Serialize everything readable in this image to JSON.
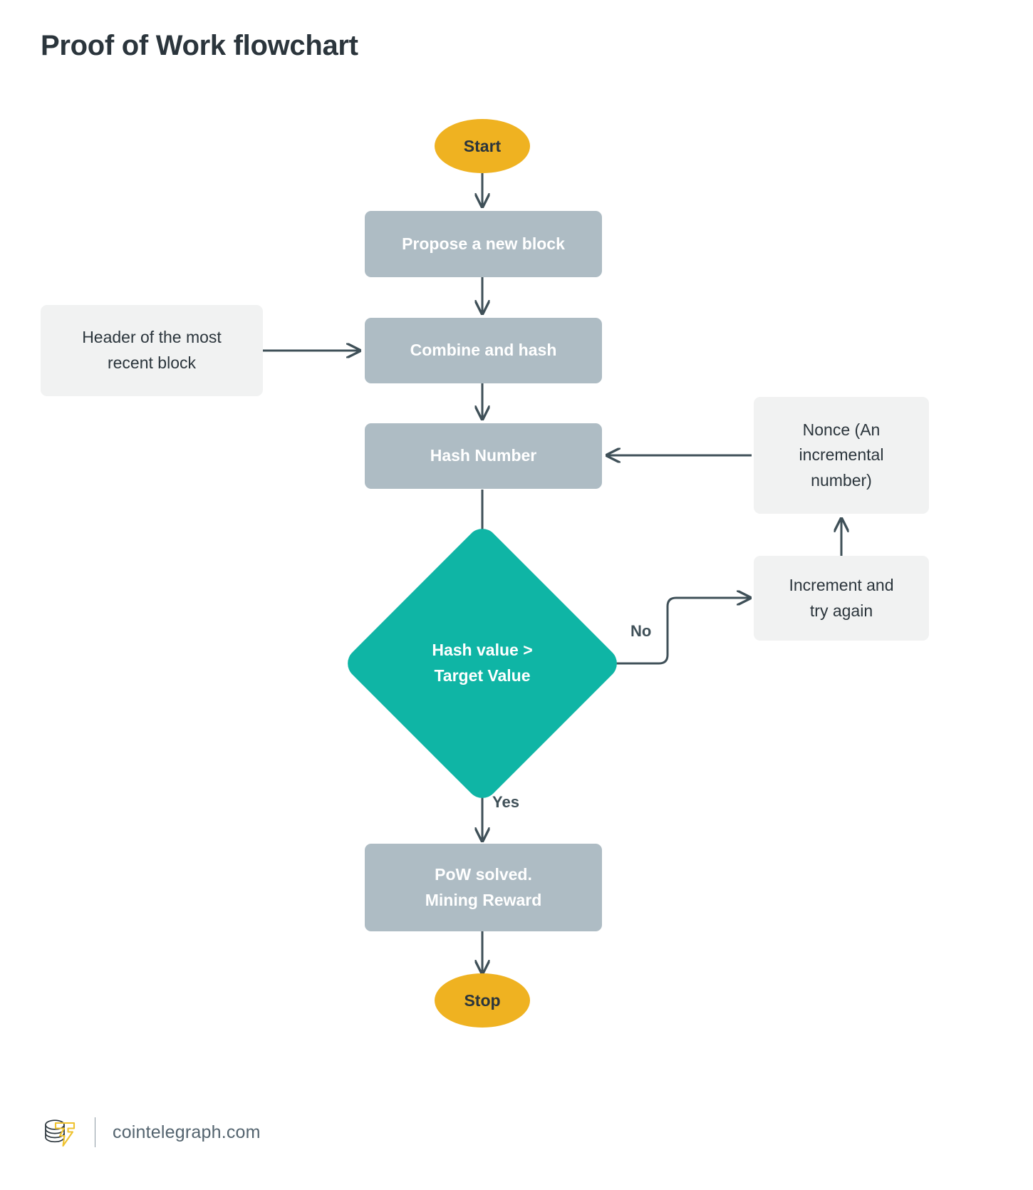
{
  "page": {
    "title": "Proof of Work flowchart",
    "background": "#ffffff"
  },
  "colors": {
    "title_text": "#2b353c",
    "terminal_fill": "#efb221",
    "terminal_text": "#2b353c",
    "process_fill": "#aebcc4",
    "process_text": "#ffffff",
    "io_fill": "#f1f2f2",
    "io_text": "#2b353c",
    "decision_fill": "#0fb5a5",
    "decision_text": "#ffffff",
    "connector_stroke": "#3f5058",
    "footer_text": "#54646f",
    "logo_accent": "#efc22f"
  },
  "chart_data": {
    "type": "diagram",
    "title": "Proof of Work flowchart",
    "nodes": [
      {
        "id": "start",
        "shape": "ellipse",
        "label": "Start"
      },
      {
        "id": "propose",
        "shape": "process",
        "label": "Propose a new block"
      },
      {
        "id": "header",
        "shape": "io",
        "label": "Header of the most recent block"
      },
      {
        "id": "combine",
        "shape": "process",
        "label": "Combine and hash"
      },
      {
        "id": "hashnum",
        "shape": "process",
        "label": "Hash Number"
      },
      {
        "id": "nonce",
        "shape": "io",
        "label": "Nonce (An incremental number)"
      },
      {
        "id": "decision",
        "shape": "diamond",
        "label": "Hash value > Target Value"
      },
      {
        "id": "increment",
        "shape": "io",
        "label": "Increment and try again"
      },
      {
        "id": "pow",
        "shape": "process",
        "label": "PoW solved. Mining Reward"
      },
      {
        "id": "stop",
        "shape": "ellipse",
        "label": "Stop"
      }
    ],
    "edges": [
      {
        "from": "start",
        "to": "propose",
        "label": ""
      },
      {
        "from": "propose",
        "to": "combine",
        "label": ""
      },
      {
        "from": "header",
        "to": "combine",
        "label": ""
      },
      {
        "from": "combine",
        "to": "hashnum",
        "label": ""
      },
      {
        "from": "nonce",
        "to": "hashnum",
        "label": ""
      },
      {
        "from": "hashnum",
        "to": "decision",
        "label": ""
      },
      {
        "from": "decision",
        "to": "increment",
        "label": "No"
      },
      {
        "from": "increment",
        "to": "nonce",
        "label": ""
      },
      {
        "from": "decision",
        "to": "pow",
        "label": "Yes"
      },
      {
        "from": "pow",
        "to": "stop",
        "label": ""
      }
    ]
  },
  "nodes": {
    "start": {
      "label": "Start"
    },
    "propose": {
      "label": "Propose a new block"
    },
    "header": {
      "line1": "Header of the most",
      "line2": "recent block"
    },
    "combine": {
      "label": "Combine and hash"
    },
    "hash_number": {
      "label": "Hash Number"
    },
    "nonce": {
      "line1": "Nonce (An",
      "line2": "incremental",
      "line3": "number)"
    },
    "decision": {
      "line1": "Hash value >",
      "line2": "Target Value"
    },
    "increment": {
      "line1": "Increment and",
      "line2": "try again"
    },
    "pow": {
      "line1": "PoW solved.",
      "line2": "Mining Reward"
    },
    "stop": {
      "label": "Stop"
    }
  },
  "labels": {
    "no": "No",
    "yes": "Yes"
  },
  "footer": {
    "site": "cointelegraph.com",
    "logo_name": "cointelegraph-logo-icon"
  }
}
